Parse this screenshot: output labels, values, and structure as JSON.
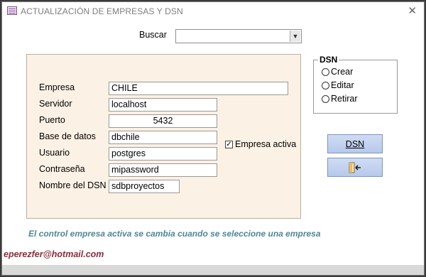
{
  "window": {
    "title": "ACTUALIZACIÓN DE EMPRESAS Y DSN",
    "close_icon": "✕"
  },
  "search": {
    "label": "Buscar",
    "value": ""
  },
  "form": {
    "fields": [
      {
        "label": "Empresa",
        "value": "CHILE"
      },
      {
        "label": "Servidor",
        "value": "localhost"
      },
      {
        "label": "Puerto",
        "value": "5432"
      },
      {
        "label": "Base de datos",
        "value": "dbchile"
      },
      {
        "label": "Usuario",
        "value": "postgres"
      },
      {
        "label": "Contraseña",
        "value": "mipassword"
      },
      {
        "label": "Nombre del DSN",
        "value": "sdbproyectos"
      }
    ],
    "empresa_activa": {
      "label": "Empresa activa",
      "checked": true
    }
  },
  "dsn_group": {
    "title": "DSN",
    "options": [
      {
        "label": "Crear",
        "selected": false
      },
      {
        "label": "Editar",
        "selected": false
      },
      {
        "label": "Retirar",
        "selected": false
      }
    ]
  },
  "buttons": {
    "dsn_label": "DSN",
    "exit_icon": "exit-door-icon"
  },
  "note": "El control empresa activa se cambia cuando se seleccione una  empresa",
  "footer": "eperezfer@hotmail.com",
  "colors": {
    "panel_bg": "#fbf1e4",
    "note": "#4e8797",
    "footer": "#8b2c3a",
    "button": "#c3d3f0"
  }
}
